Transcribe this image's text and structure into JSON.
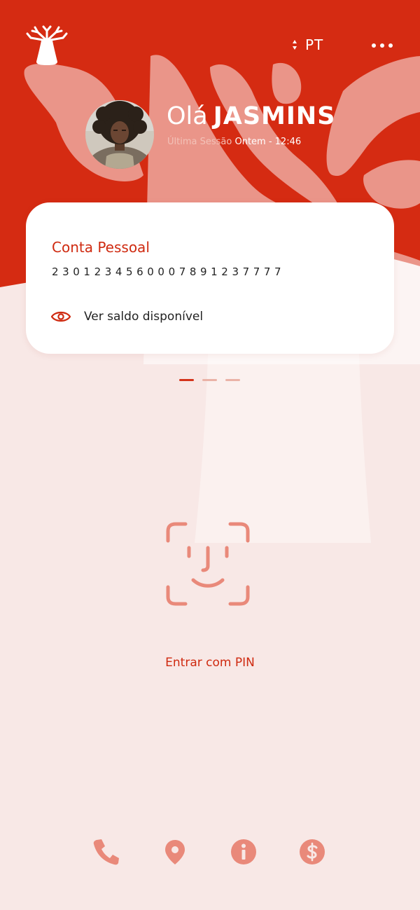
{
  "header": {
    "language": "PT"
  },
  "user": {
    "greeting": "Olá",
    "name": "JASMINS",
    "last_session_label": "Última Sessão",
    "last_session_value": "Ontem - 12:46"
  },
  "account_card": {
    "title": "Conta Pessoal",
    "number": "2301234560007891237777",
    "balance_label": "Ver saldo disponível"
  },
  "carousel": {
    "total": 3,
    "active": 1
  },
  "login": {
    "pin_label": "Entrar com PIN"
  },
  "bottom_icons": [
    "phone-icon",
    "location-pin-icon",
    "info-icon",
    "dollar-icon"
  ],
  "colors": {
    "primary_red": "#d52b12",
    "background": "#f8e8e6",
    "accent_soft": "#e9897a",
    "card": "#ffffff"
  }
}
